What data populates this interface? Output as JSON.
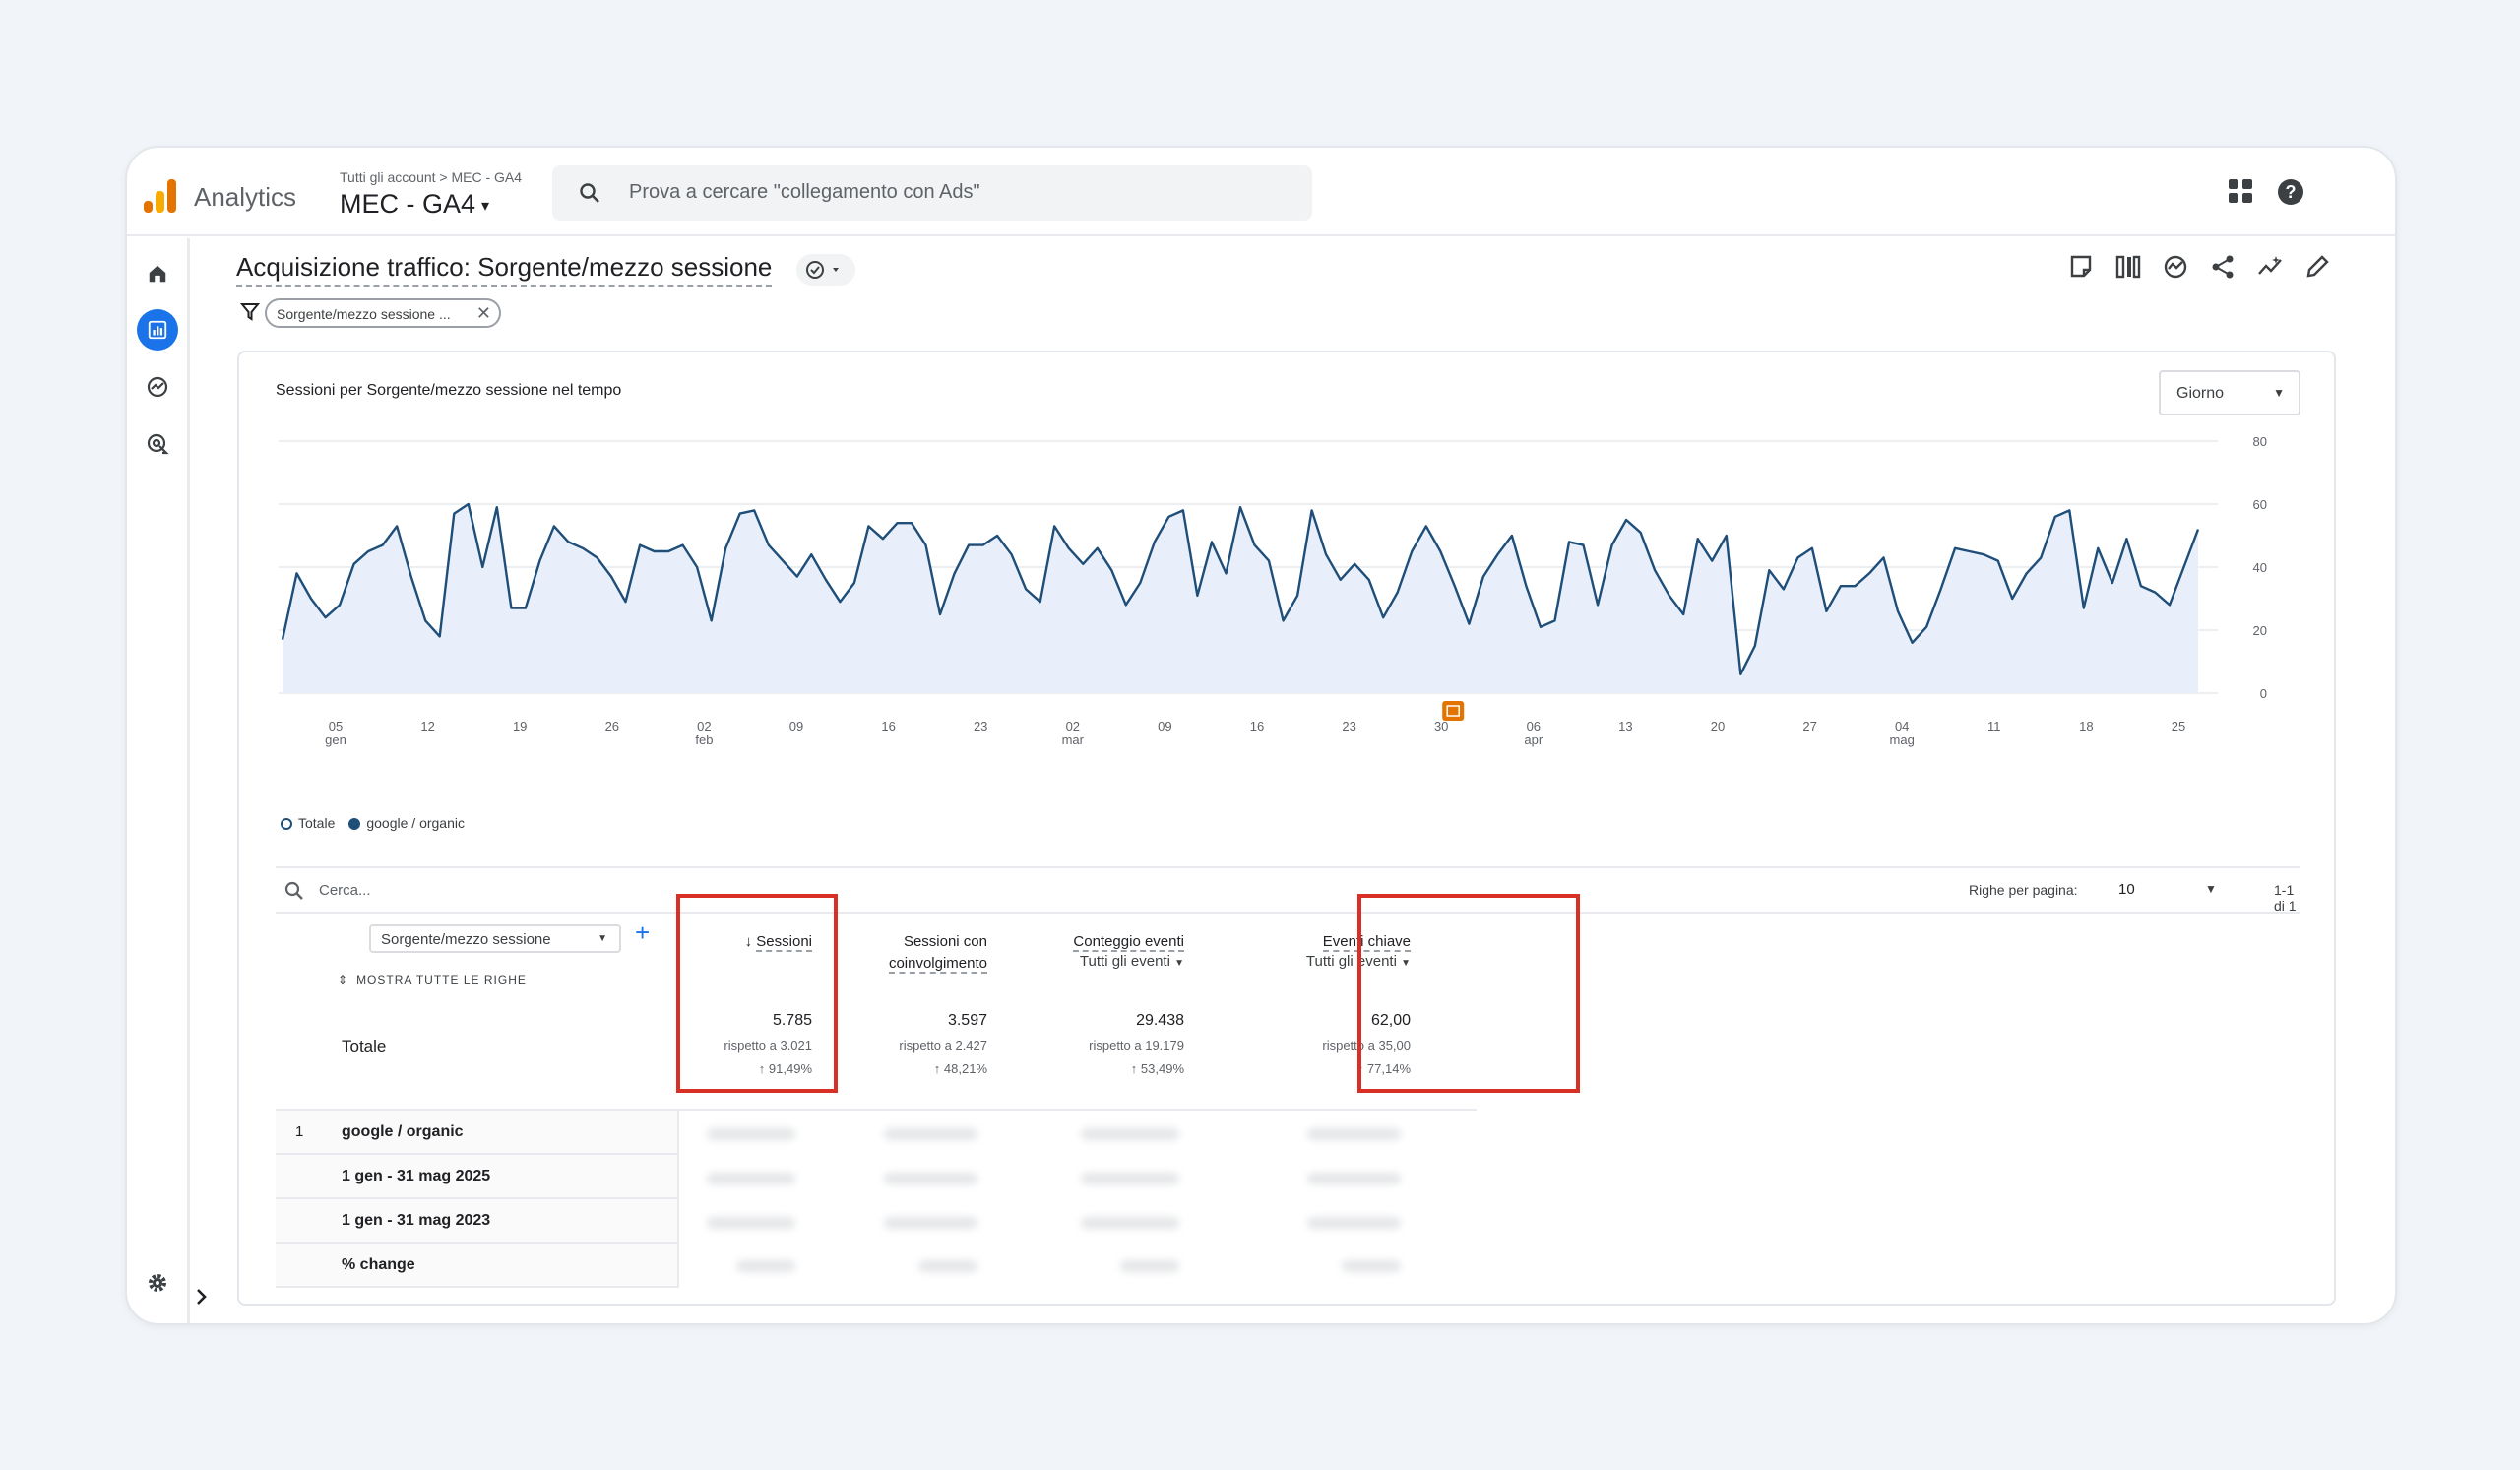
{
  "header": {
    "app_name": "Analytics",
    "breadcrumb": "Tutti gli account > MEC - GA4",
    "property_name": "MEC - GA4",
    "search_placeholder": "Prova a cercare \"collegamento con Ads\""
  },
  "page": {
    "title": "Acquisizione traffico: Sorgente/mezzo sessione",
    "filter_chip": "Sorgente/mezzo sessione ..."
  },
  "chart": {
    "title": "Sessioni per Sorgente/mezzo sessione nel tempo",
    "period": "Giorno",
    "legend": [
      "Totale",
      "google / organic"
    ],
    "colors": {
      "line": "#1f4e79",
      "area": "#e8effa",
      "annotation": "#e37400"
    }
  },
  "chart_data": {
    "type": "area",
    "y_ticks": [
      "0",
      "20",
      "40",
      "60",
      "80"
    ],
    "ylim": [
      0,
      80
    ],
    "x_ticks": [
      {
        "day": "05",
        "month": "gen"
      },
      {
        "day": "12",
        "month": ""
      },
      {
        "day": "19",
        "month": ""
      },
      {
        "day": "26",
        "month": ""
      },
      {
        "day": "02",
        "month": "feb"
      },
      {
        "day": "09",
        "month": ""
      },
      {
        "day": "16",
        "month": ""
      },
      {
        "day": "23",
        "month": ""
      },
      {
        "day": "02",
        "month": "mar"
      },
      {
        "day": "09",
        "month": ""
      },
      {
        "day": "16",
        "month": ""
      },
      {
        "day": "23",
        "month": ""
      },
      {
        "day": "30",
        "month": ""
      },
      {
        "day": "06",
        "month": "apr"
      },
      {
        "day": "13",
        "month": ""
      },
      {
        "day": "20",
        "month": ""
      },
      {
        "day": "27",
        "month": ""
      },
      {
        "day": "04",
        "month": "mag"
      },
      {
        "day": "11",
        "month": ""
      },
      {
        "day": "18",
        "month": ""
      },
      {
        "day": "25",
        "month": ""
      }
    ],
    "series": [
      {
        "name": "google / organic",
        "values": [
          17,
          38,
          30,
          24,
          28,
          41,
          45,
          47,
          53,
          37,
          23,
          18,
          57,
          60,
          40,
          59,
          27,
          27,
          42,
          53,
          48,
          46,
          43,
          37,
          29,
          47,
          45,
          45,
          47,
          40,
          23,
          46,
          57,
          58,
          47,
          42,
          37,
          44,
          36,
          29,
          35,
          53,
          49,
          54,
          54,
          47,
          25,
          38,
          47,
          47,
          50,
          44,
          33,
          29,
          53,
          46,
          41,
          46,
          39,
          28,
          35,
          48,
          56,
          58,
          31,
          48,
          38,
          59,
          47,
          42,
          23,
          31,
          58,
          44,
          36,
          41,
          36,
          24,
          32,
          45,
          53,
          45,
          34,
          22,
          37,
          44,
          50,
          34,
          21,
          23,
          48,
          47,
          28,
          47,
          55,
          51,
          39,
          31,
          25,
          49,
          42,
          50,
          6,
          15,
          39,
          33,
          43,
          46,
          26,
          34,
          34,
          38,
          43,
          26,
          16,
          21,
          33,
          46,
          45,
          44,
          42,
          30,
          38,
          43,
          56,
          58,
          27,
          46,
          35,
          49,
          34,
          32,
          28,
          40,
          52
        ]
      }
    ]
  },
  "table": {
    "search_placeholder": "Cerca...",
    "rows_per_page_label": "Righe per pagina:",
    "rows_per_page_value": "10",
    "range": "1-1 di 1",
    "dimension": "Sorgente/mezzo sessione",
    "show_all_rows": "MOSTRA TUTTE LE RIGHE",
    "total_label": "Totale",
    "metrics": [
      {
        "head1": "",
        "head2": "Sessioni",
        "sub": "",
        "value": "5.785",
        "compare": "rispetto a 3.021",
        "change": "91,49%"
      },
      {
        "head1": "Sessioni con",
        "head2": "coinvolgimento",
        "sub": "",
        "value": "3.597",
        "compare": "rispetto a 2.427",
        "change": "48,21%"
      },
      {
        "head1": "Conteggio eventi",
        "head2": "",
        "sub": "Tutti gli eventi",
        "value": "29.438",
        "compare": "rispetto a 19.179",
        "change": "53,49%"
      },
      {
        "head1": "Eventi chiave",
        "head2": "",
        "sub": "Tutti gli eventi",
        "value": "62,00",
        "compare": "rispetto a 35,00",
        "change": "77,14%"
      }
    ],
    "rows": [
      {
        "num": "1",
        "label": "google / organic"
      },
      {
        "num": "",
        "label": "1 gen - 31 mag 2025"
      },
      {
        "num": "",
        "label": "1 gen - 31 mag 2023"
      },
      {
        "num": "",
        "label": "% change"
      }
    ]
  }
}
